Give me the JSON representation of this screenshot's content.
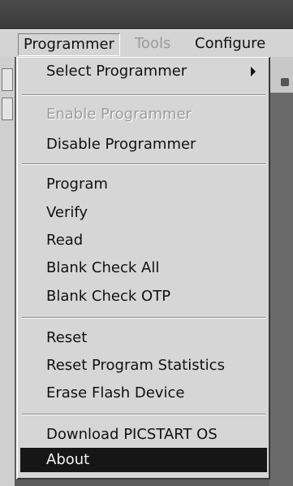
{
  "menubar": {
    "items": [
      {
        "label": "Programmer",
        "state": "open"
      },
      {
        "label": "Tools",
        "state": "disabled"
      },
      {
        "label": "Configure",
        "state": "normal"
      }
    ]
  },
  "programmer_menu": {
    "items": [
      {
        "label": "Select Programmer",
        "enabled": true,
        "has_submenu": true
      },
      {
        "label": "Enable Programmer",
        "enabled": false
      },
      {
        "label": "Disable Programmer",
        "enabled": true
      },
      {
        "label": "Program",
        "enabled": true
      },
      {
        "label": "Verify",
        "enabled": true
      },
      {
        "label": "Read",
        "enabled": true
      },
      {
        "label": "Blank Check All",
        "enabled": true
      },
      {
        "label": "Blank Check OTP",
        "enabled": true
      },
      {
        "label": "Reset",
        "enabled": true
      },
      {
        "label": "Reset Program Statistics",
        "enabled": true
      },
      {
        "label": "Erase Flash Device",
        "enabled": true
      },
      {
        "label": "Download PICSTART OS",
        "enabled": true
      },
      {
        "label": "About",
        "enabled": true,
        "highlighted": true
      }
    ]
  },
  "colors": {
    "menu_background": "#d6d6d6",
    "highlight_background": "#161616",
    "highlight_text": "#f2f2f2",
    "disabled_text": "#9c9c9c"
  },
  "icons": {
    "submenu_indicator": "chevron-right-icon"
  }
}
